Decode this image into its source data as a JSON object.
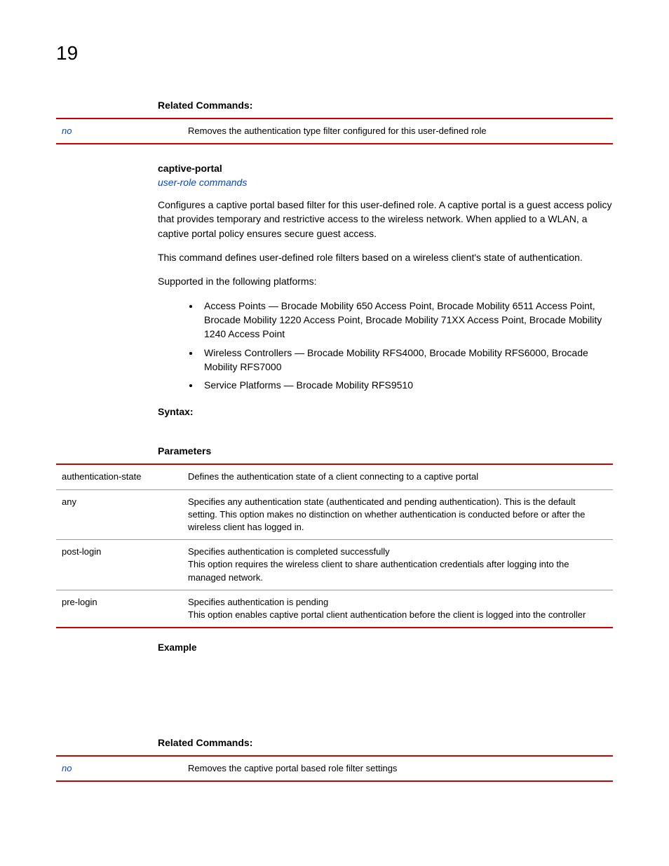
{
  "pageNumber": "19",
  "relatedCommands1": {
    "heading": "Related Commands:",
    "row": {
      "cmd": "no",
      "desc": "Removes the authentication type filter configured for this user-defined role"
    }
  },
  "captivePortal": {
    "title": "captive-portal",
    "link": "user-role commands",
    "para1": "Configures a captive portal based filter for this user-defined role. A captive portal is a guest access policy that provides temporary and restrictive access to the wireless network. When applied to a WLAN, a captive portal policy ensures secure guest access.",
    "para2": "This command defines user-defined role filters based on a wireless client's state of authentication.",
    "para3": "Supported in the following platforms:",
    "bullets": [
      "Access Points — Brocade Mobility 650 Access Point, Brocade Mobility 6511 Access Point, Brocade Mobility 1220 Access Point, Brocade Mobility 71XX Access Point, Brocade Mobility 1240 Access Point",
      "Wireless Controllers — Brocade Mobility RFS4000, Brocade Mobility RFS6000, Brocade Mobility RFS7000",
      "Service Platforms — Brocade Mobility RFS9510"
    ]
  },
  "syntaxHeading": "Syntax:",
  "parametersHeading": "Parameters",
  "params": [
    {
      "name": "authentication-state",
      "desc": "Defines the authentication state of a client connecting to a captive portal"
    },
    {
      "name": "any",
      "desc": "Specifies any authentication state (authenticated and pending authentication). This is the default setting. This option makes no distinction on whether authentication is conducted before or after the wireless client has logged in."
    },
    {
      "name": "post-login",
      "desc": "Specifies authentication is completed successfully\nThis option requires the wireless client to share authentication credentials after logging into the managed network."
    },
    {
      "name": "pre-login",
      "desc": "Specifies authentication is pending\nThis option enables captive portal client authentication before the client is logged into the controller"
    }
  ],
  "exampleHeading": "Example",
  "relatedCommands2": {
    "heading": "Related Commands:",
    "row": {
      "cmd": "no",
      "desc": "Removes the captive portal based role filter settings"
    }
  }
}
